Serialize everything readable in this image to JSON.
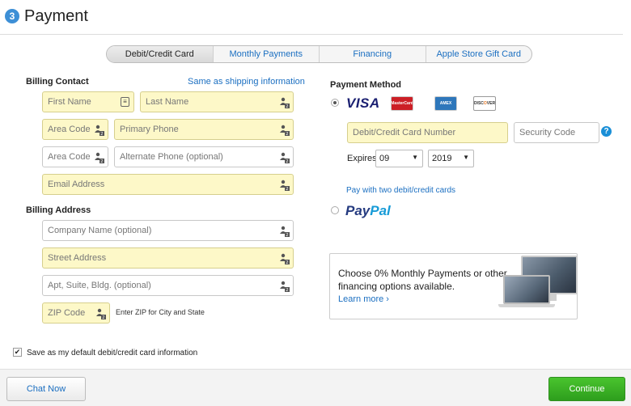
{
  "header": {
    "step_number": "3",
    "title": "Payment"
  },
  "tabs": [
    {
      "label": "Debit/Credit Card",
      "active": true
    },
    {
      "label": "Monthly Payments",
      "active": false
    },
    {
      "label": "Financing",
      "active": false
    },
    {
      "label": "Apple Store Gift Card",
      "active": false
    }
  ],
  "billing_contact": {
    "label": "Billing Contact",
    "same_as_shipping": "Same as shipping information",
    "first_name": "First Name",
    "last_name": "Last Name",
    "area_code": "Area Code",
    "primary_phone": "Primary Phone",
    "alt_area_code": "Area Code",
    "alternate_phone": "Alternate Phone (optional)",
    "email": "Email Address"
  },
  "billing_address": {
    "label": "Billing Address",
    "company": "Company Name (optional)",
    "street": "Street Address",
    "apt": "Apt, Suite, Bldg. (optional)",
    "zip": "ZIP Code",
    "zip_hint": "Enter ZIP for City and State"
  },
  "payment_method": {
    "label": "Payment Method",
    "visa": "VISA",
    "mastercard": "MasterCard",
    "amex": "AMEX",
    "discover_pre": "DISC",
    "discover_o": "O",
    "discover_post": "VER",
    "card_number": "Debit/Credit Card Number",
    "security_code": "Security Code",
    "help": "?",
    "expires_label": "Expires",
    "expires_month": "09",
    "expires_year": "2019",
    "two_cards_link": "Pay with two debit/credit cards",
    "paypal_p1": "Pay",
    "paypal_p2": "Pal"
  },
  "promo": {
    "text": "Choose 0% Monthly Payments or other financing options available.",
    "link": "Learn more ›"
  },
  "save_default": {
    "label": "Save as my default debit/credit card information",
    "checked": true,
    "check_glyph": "✔"
  },
  "footer": {
    "chat": "Chat Now",
    "continue": "Continue"
  },
  "colors": {
    "accent": "#1b6fc1",
    "required_fill": "#fdf8c8",
    "continue": "#3aae24"
  },
  "icons": {
    "autofill": "contact-card-icon",
    "card": "id-card-icon",
    "select": "chevron-down-icon"
  }
}
